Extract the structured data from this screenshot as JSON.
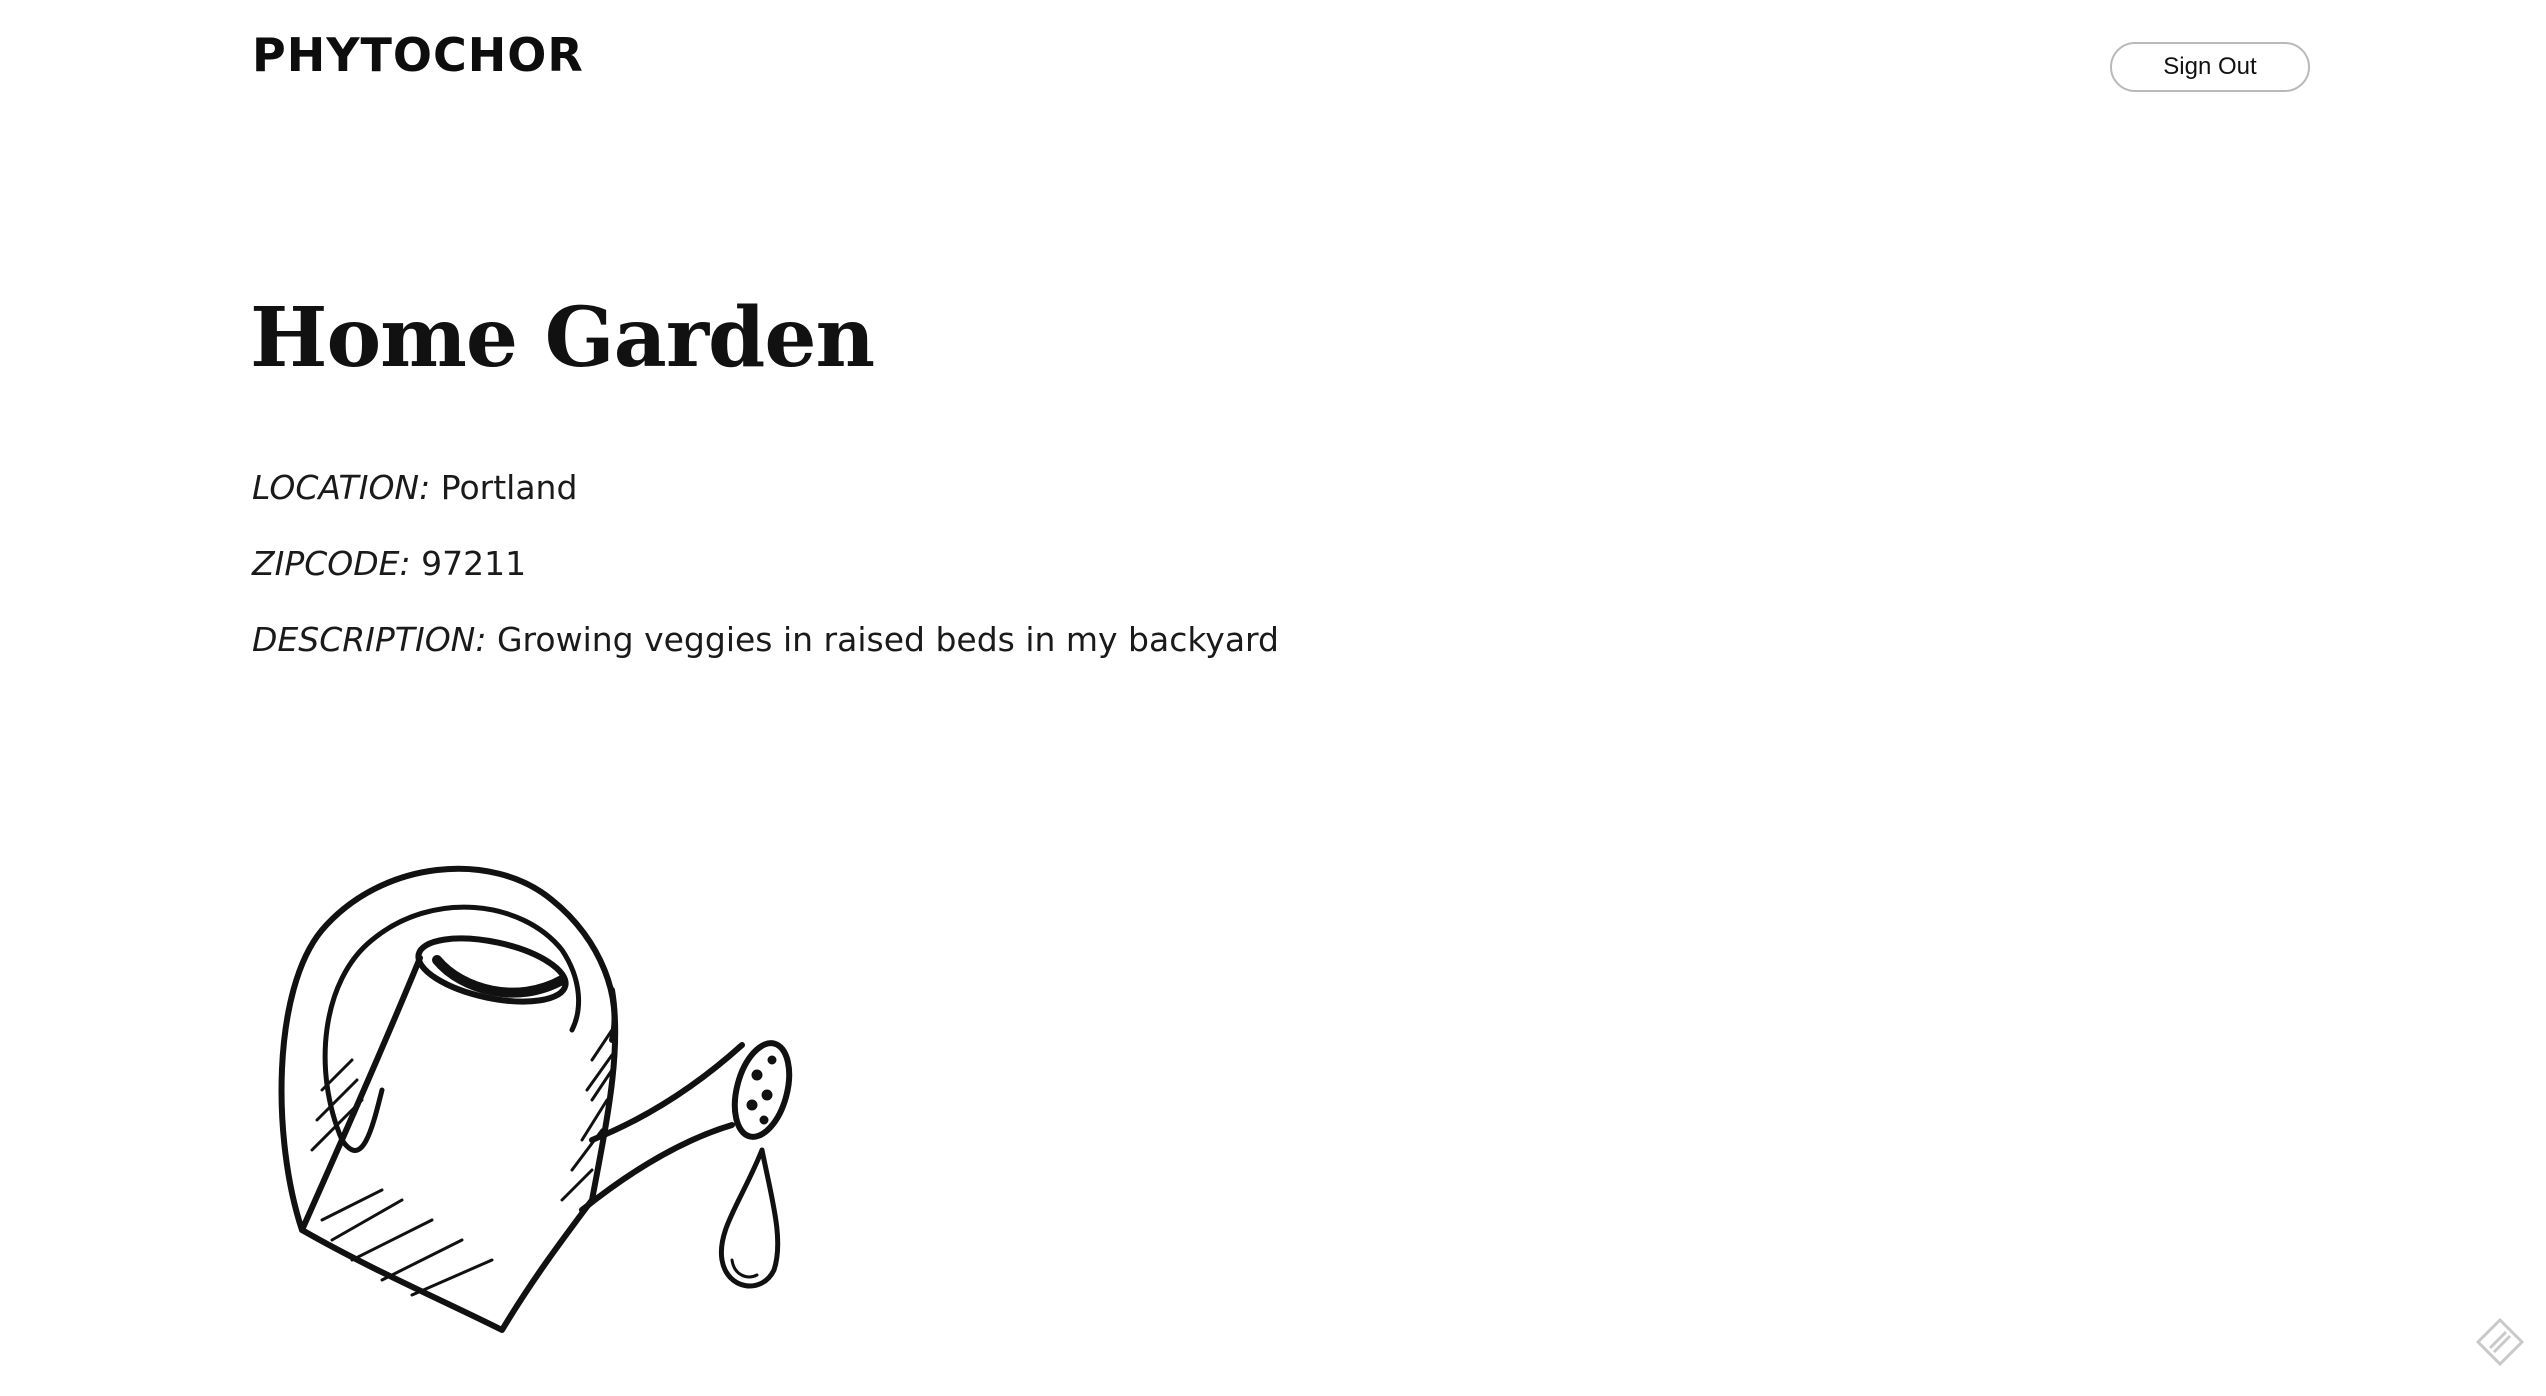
{
  "header": {
    "brand": "PHYTOCHOR",
    "sign_out_label": "Sign Out"
  },
  "garden": {
    "name": "Home Garden",
    "location_label": "LOCATION:",
    "location": "Portland",
    "zipcode_label": "ZIPCODE:",
    "zipcode": "97211",
    "description_label": "DESCRIPTION:",
    "description": "Growing veggies in raised beds in my backyard"
  },
  "icons": {
    "illustration": "watering-can-icon",
    "corner": "feedback-icon"
  }
}
